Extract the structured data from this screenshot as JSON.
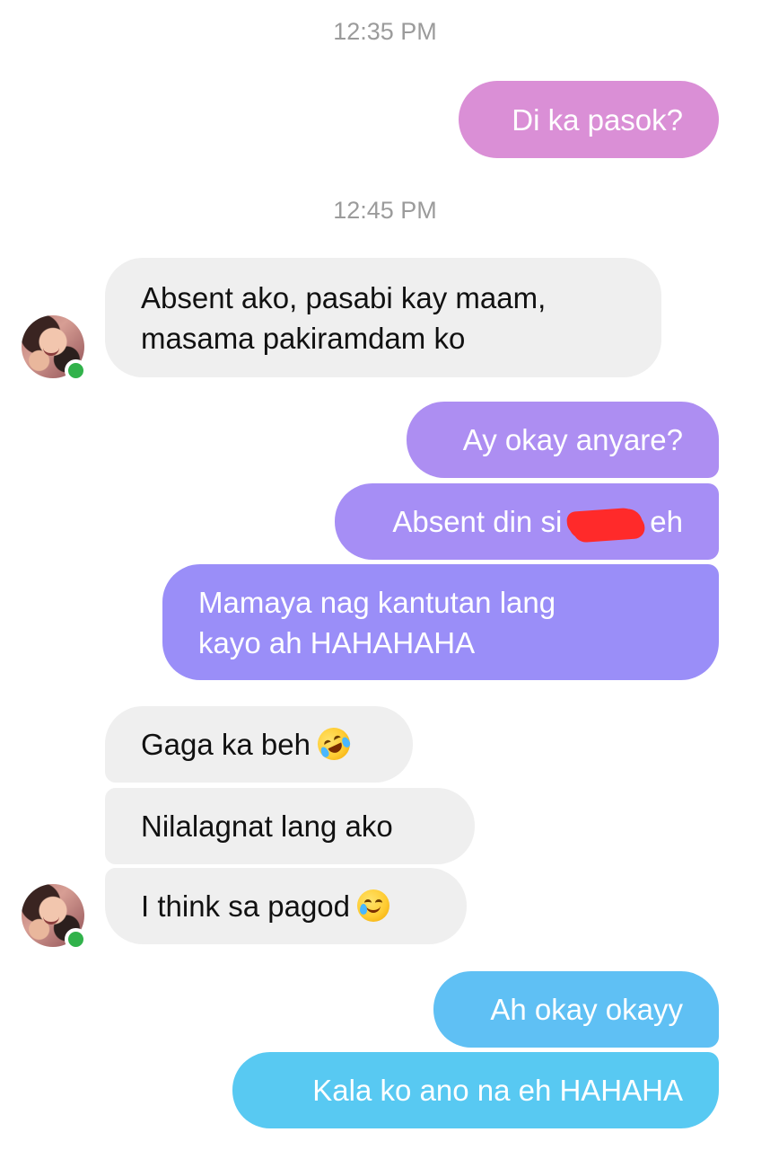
{
  "timestamps": {
    "first": "12:35 PM",
    "second": "12:45 PM"
  },
  "messages": {
    "out_1": "Di ka pasok?",
    "in_1_line1": "Absent ako, pasabi kay maam,",
    "in_1_line2": "masama pakiramdam ko",
    "out_2": "Ay okay anyare?",
    "out_3_before": "Absent din si",
    "out_3_after": "eh",
    "out_4_line1": "Mamaya nag kantutan lang",
    "out_4_line2": "kayo ah HAHAHAHA",
    "in_2": "Gaga ka beh",
    "in_3": "Nilalagnat lang ako",
    "in_4": "I think sa pagod",
    "out_5": "Ah okay okayy",
    "out_6": "Kala ko ano na eh HAHAHA"
  },
  "icons": {
    "emoji_in_2": "rolling-on-floor-laughing",
    "emoji_in_4": "smiling-face-with-tear"
  },
  "colors": {
    "incoming_bubble": "#efefef",
    "outgoing_pink": "#da8fd6",
    "outgoing_purple": "#ad8ef2",
    "outgoing_violet": "#9a8ef8",
    "outgoing_blue": "#5fc0f4",
    "online_green": "#31b24b",
    "timestamp": "#9b9b9b",
    "redaction": "#ff2a2a"
  }
}
